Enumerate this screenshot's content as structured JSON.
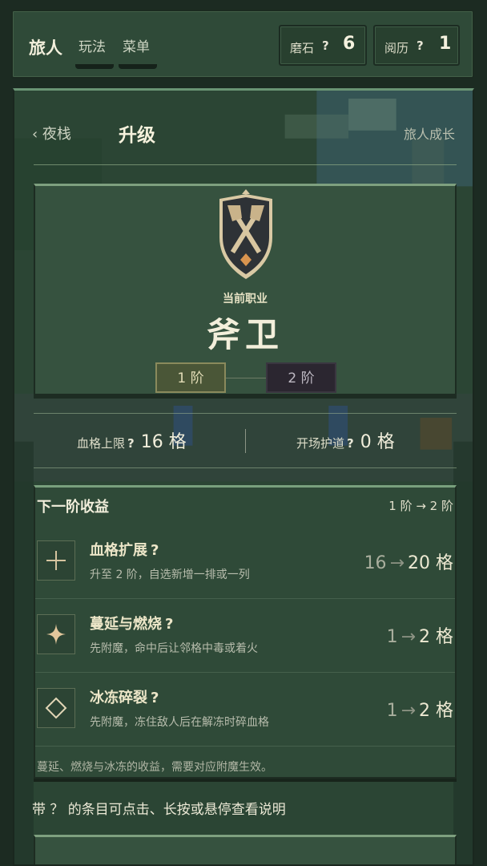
{
  "topbar": {
    "brand": "旅人",
    "tabs": [
      "玩法",
      "菜单"
    ],
    "stats": [
      {
        "label": "磨石",
        "help": "?",
        "value": "6"
      },
      {
        "label": "阅历",
        "help": "?",
        "value": "1"
      }
    ]
  },
  "header": {
    "back_label": "‹ 夜栈",
    "title": "升级",
    "growth_link": "旅人成长"
  },
  "job": {
    "current_label": "当前职业",
    "name": "斧卫",
    "tiers": [
      "1 阶",
      "2 阶"
    ],
    "active_tier": 1,
    "emblem_icon": "crossed-axes-shield-icon"
  },
  "info": {
    "hp_label": "血格上限",
    "hp_help": "?",
    "hp_value": "16 格",
    "guard_label": "开场护道",
    "guard_help": "?",
    "guard_value": "0 格"
  },
  "gains": {
    "title": "下一阶收益",
    "range": "1 阶 → 2 阶",
    "rows": [
      {
        "icon": "plus-icon",
        "name": "血格扩展",
        "help": "?",
        "desc": "升至 2 阶，自选新增一排或一列",
        "from": "16",
        "arrow": "→",
        "to": "20 格"
      },
      {
        "icon": "sparkle-icon",
        "name": "蔓延与燃烧",
        "help": "?",
        "desc": "先附魔，命中后让邻格中毒或着火",
        "from": "1",
        "arrow": "→",
        "to": "2 格"
      },
      {
        "icon": "diamond-icon",
        "name": "冰冻碎裂",
        "help": "?",
        "desc": "先附魔，冻住敌人后在解冻时碎血格",
        "from": "1",
        "arrow": "→",
        "to": "2 格"
      }
    ],
    "note": "蔓延、燃烧与冰冻的收益，需要对应附魔生效。"
  },
  "hint": "带 ？ 的条目可点击、长按或悬停查看说明",
  "colors": {
    "panel": "#2b4534",
    "card": "#36523f",
    "accent_border": "#7ea07f",
    "text": "#e8e6d6",
    "gold": "#d9b98a"
  }
}
